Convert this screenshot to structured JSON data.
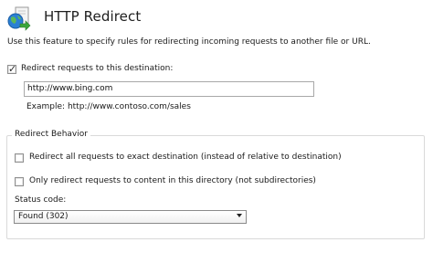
{
  "header": {
    "title": "HTTP Redirect",
    "icon": "globe-redirect-icon"
  },
  "description": "Use this feature to specify rules for redirecting incoming requests to another file or URL.",
  "redirect": {
    "checkbox_label": "Redirect requests to this destination:",
    "checked": true,
    "destination_value": "http://www.bing.com",
    "example": "Example: http://www.contoso.com/sales"
  },
  "behavior": {
    "legend": "Redirect Behavior",
    "exact_label": "Redirect all requests to exact destination (instead of relative to destination)",
    "exact_checked": false,
    "only_dir_label": "Only redirect requests to content in this directory (not subdirectories)",
    "only_dir_checked": false,
    "status_label": "Status code:",
    "status_value": "Found (302)"
  },
  "colors": {
    "globe_blue": "#2a7fd4",
    "arrow_green": "#3aa53a",
    "group_border": "#d9d9d9"
  }
}
